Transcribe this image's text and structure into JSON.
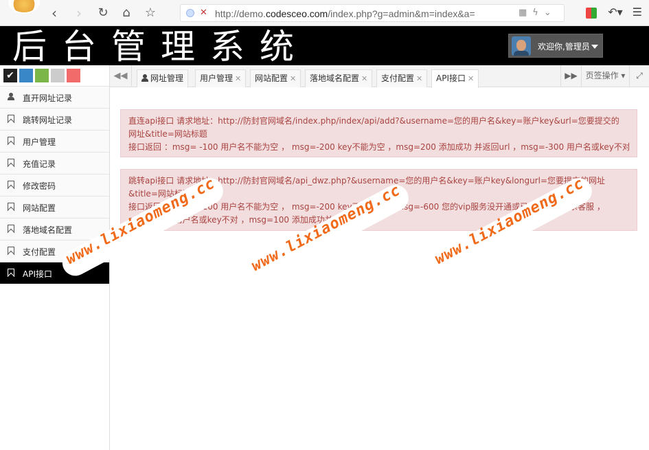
{
  "browser": {
    "url_prefix": "http://demo.",
    "url_domain": "codesceo.com",
    "url_rest": "/index.php?g=admin&m=index&a="
  },
  "header": {
    "title": "后台管理系统",
    "welcome": "欢迎你,管理员"
  },
  "theme_swatches": [
    "#222222",
    "#3a87c8",
    "#7ab648",
    "#cccccc",
    "#f26b6b"
  ],
  "sidebar": {
    "items": [
      {
        "label": "直开网址记录",
        "icon": "user-icon"
      },
      {
        "label": "跳转网址记录",
        "icon": "bookmark-icon"
      },
      {
        "label": "用户管理",
        "icon": "bookmark-icon"
      },
      {
        "label": "充值记录",
        "icon": "bookmark-icon"
      },
      {
        "label": "修改密码",
        "icon": "bookmark-icon"
      },
      {
        "label": "网站配置",
        "icon": "bookmark-icon"
      },
      {
        "label": "落地域名配置",
        "icon": "bookmark-icon"
      },
      {
        "label": "支付配置",
        "icon": "bookmark-icon"
      },
      {
        "label": "API接口",
        "icon": "bookmark-icon",
        "active": true
      }
    ]
  },
  "tabs": {
    "items": [
      {
        "label": "网址管理"
      },
      {
        "label": "用户管理"
      },
      {
        "label": "网站配置"
      },
      {
        "label": "落地域名配置"
      },
      {
        "label": "支付配置"
      },
      {
        "label": "API接口",
        "active": true
      }
    ],
    "page_actions": "页签操作"
  },
  "alerts": [
    {
      "lines": [
        "直连api接口 请求地址：http://防封官网域名/index.php/index/api/add?&username=您的用户名&key=账户key&url=您要提交的",
        "网址&title=网站标题",
        "接口返回 ：msg= -100 用户名不能为空 ， msg=-200 key不能为空 ，msg=200 添加成功 并返回url ，msg=-300 用户名或key不对"
      ]
    },
    {
      "lines": [
        "跳转api接口 请求地址：http://防封官网域名/api_dwz.php?&username=您的用户名&key=账户key&longurl=您要提交的网址",
        "&title=网站标题",
        "接口返回 ：msg= -100 用户名不能为空 ， msg=-200 key不能为空 ，msg=-600 您的vip服务没开通或已到期，请联系客服 ，",
        "msg=-300 用户名或key不对 ，msg=100 添加成功并返回url"
      ]
    }
  ],
  "watermark": "www.lixiaomeng.cc"
}
